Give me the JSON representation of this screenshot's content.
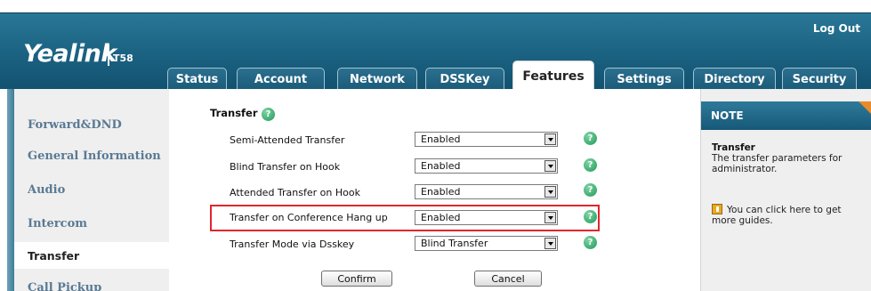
{
  "header": {
    "logo": "Yealink",
    "model": "T58",
    "logout": "Log Out"
  },
  "tabs": [
    {
      "label": "Status",
      "active": false
    },
    {
      "label": "Account",
      "active": false
    },
    {
      "label": "Network",
      "active": false
    },
    {
      "label": "DSSKey",
      "active": false
    },
    {
      "label": "Features",
      "active": true
    },
    {
      "label": "Settings",
      "active": false
    },
    {
      "label": "Directory",
      "active": false
    },
    {
      "label": "Security",
      "active": false
    }
  ],
  "sidebar": {
    "items": [
      {
        "label": "Forward&DND",
        "active": false
      },
      {
        "label": "General Information",
        "active": false
      },
      {
        "label": "Audio",
        "active": false
      },
      {
        "label": "Intercom",
        "active": false
      },
      {
        "label": "Transfer",
        "active": true
      },
      {
        "label": "Call Pickup",
        "active": false
      }
    ]
  },
  "main": {
    "section_title": "Transfer",
    "help_glyph": "?",
    "rows": [
      {
        "label": "Semi-Attended Transfer",
        "value": "Enabled"
      },
      {
        "label": "Blind Transfer on Hook",
        "value": "Enabled"
      },
      {
        "label": "Attended Transfer on Hook",
        "value": "Enabled"
      },
      {
        "label": "Transfer on Conference Hang up",
        "value": "Enabled"
      },
      {
        "label": "Transfer Mode via Dsskey",
        "value": "Blind Transfer"
      }
    ],
    "confirm": "Confirm",
    "cancel": "Cancel"
  },
  "note": {
    "header": "NOTE",
    "title": "Transfer",
    "text": "The transfer parameters for administrator.",
    "guide": "You can click here to get more guides."
  },
  "colors": {
    "header_blue": "#1d6585",
    "highlight_red": "#e0262c",
    "help_green": "#1f9a5b",
    "note_corner_orange": "#e98a2b"
  },
  "icons": {
    "help": "question-circle-icon",
    "dropdown": "chevron-down-icon",
    "guide": "guide-book-icon"
  }
}
